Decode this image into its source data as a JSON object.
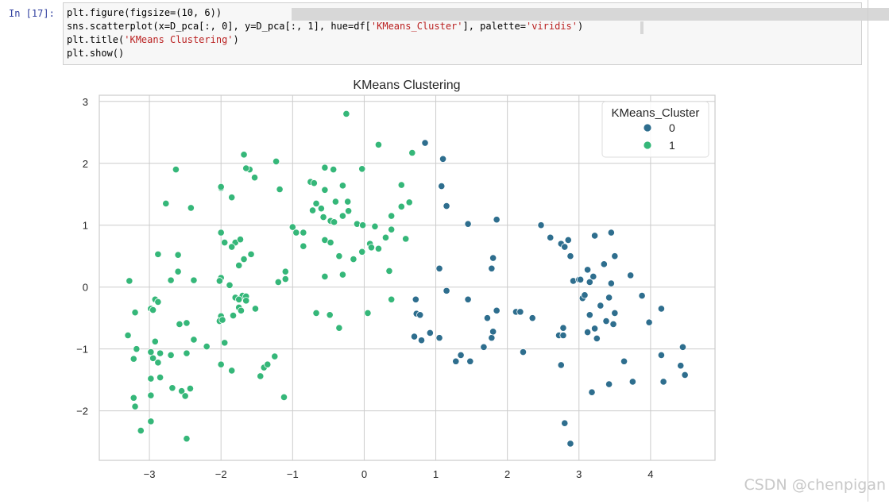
{
  "cell": {
    "prompt": "In  [17]:",
    "code": {
      "line1": "plt.figure(figsize=(10, 6))",
      "line2_a": "sns.scatterplot(x=D_pca[:, 0], y=D_pca[:, 1], hue=df[",
      "line2_str": "'KMeans_Cluster'",
      "line2_b": "], palette=",
      "line2_str2": "'viridis'",
      "line2_c": ")",
      "line3_a": "plt.title(",
      "line3_str": "'KMeans Clustering'",
      "line3_b": ")",
      "line4": "plt.show()"
    }
  },
  "watermark": "CSDN @chenpigan",
  "chart_data": {
    "type": "scatter",
    "title": "KMeans Clustering",
    "xlabel": "",
    "ylabel": "",
    "xlim": [
      -3.7,
      4.9
    ],
    "ylim": [
      -2.8,
      3.1
    ],
    "xticks": [
      "−3",
      "−2",
      "−1",
      "0",
      "1",
      "2",
      "3",
      "4"
    ],
    "yticks": [
      "−2",
      "−1",
      "0",
      "1",
      "2",
      "3"
    ],
    "grid": true,
    "legend": {
      "title": "KMeans_Cluster",
      "position": "top-right",
      "entries": [
        "0",
        "1"
      ]
    },
    "colors": {
      "0": "#2e6e8e",
      "1": "#35b779"
    },
    "series": [
      {
        "name": "0",
        "points": [
          [
            0.85,
            2.33
          ],
          [
            1.1,
            2.07
          ],
          [
            1.08,
            1.63
          ],
          [
            1.15,
            1.31
          ],
          [
            1.45,
            1.02
          ],
          [
            1.85,
            1.09
          ],
          [
            1.05,
            0.3
          ],
          [
            1.8,
            0.47
          ],
          [
            1.78,
            0.3
          ],
          [
            0.72,
            -0.2
          ],
          [
            1.15,
            -0.06
          ],
          [
            1.45,
            -0.2
          ],
          [
            1.85,
            -0.38
          ],
          [
            0.73,
            -0.43
          ],
          [
            0.78,
            -0.45
          ],
          [
            0.7,
            -0.8
          ],
          [
            0.8,
            -0.86
          ],
          [
            0.92,
            -0.74
          ],
          [
            1.05,
            -0.82
          ],
          [
            1.28,
            -1.2
          ],
          [
            1.35,
            -1.1
          ],
          [
            1.48,
            -1.2
          ],
          [
            1.67,
            -0.97
          ],
          [
            1.72,
            -0.5
          ],
          [
            1.78,
            -0.82
          ],
          [
            1.8,
            -0.72
          ],
          [
            2.12,
            -0.4
          ],
          [
            2.18,
            -0.4
          ],
          [
            2.22,
            -1.05
          ],
          [
            2.35,
            -0.5
          ],
          [
            2.47,
            1.0
          ],
          [
            2.6,
            0.8
          ],
          [
            2.75,
            0.7
          ],
          [
            2.8,
            0.65
          ],
          [
            2.85,
            0.76
          ],
          [
            2.88,
            0.5
          ],
          [
            2.92,
            0.1
          ],
          [
            3.0,
            0.12
          ],
          [
            3.02,
            0.12
          ],
          [
            3.12,
            0.28
          ],
          [
            3.15,
            0.08
          ],
          [
            3.2,
            0.17
          ],
          [
            3.22,
            0.83
          ],
          [
            3.35,
            0.37
          ],
          [
            3.45,
            0.88
          ],
          [
            3.5,
            0.5
          ],
          [
            3.45,
            0.06
          ],
          [
            3.05,
            -0.18
          ],
          [
            3.08,
            -0.13
          ],
          [
            3.15,
            -0.45
          ],
          [
            3.3,
            -0.3
          ],
          [
            3.38,
            -0.55
          ],
          [
            3.42,
            -0.17
          ],
          [
            3.5,
            -0.42
          ],
          [
            3.48,
            -0.6
          ],
          [
            3.22,
            -0.67
          ],
          [
            3.12,
            -0.73
          ],
          [
            3.25,
            -0.83
          ],
          [
            2.72,
            -0.78
          ],
          [
            2.78,
            -0.66
          ],
          [
            2.78,
            -0.78
          ],
          [
            2.75,
            -1.26
          ],
          [
            3.63,
            -1.2
          ],
          [
            3.72,
            0.19
          ],
          [
            3.88,
            -0.14
          ],
          [
            3.98,
            -0.57
          ],
          [
            4.15,
            -0.35
          ],
          [
            4.15,
            -1.1
          ],
          [
            4.18,
            -1.53
          ],
          [
            4.42,
            -1.27
          ],
          [
            4.45,
            -0.97
          ],
          [
            4.48,
            -1.42
          ],
          [
            3.18,
            -1.7
          ],
          [
            3.42,
            -1.57
          ],
          [
            3.75,
            -1.53
          ],
          [
            2.8,
            -2.2
          ],
          [
            2.88,
            -2.53
          ]
        ]
      },
      {
        "name": "1",
        "points": [
          [
            -0.25,
            2.8
          ],
          [
            0.2,
            2.3
          ],
          [
            0.67,
            2.17
          ],
          [
            -1.68,
            2.14
          ],
          [
            -1.6,
            1.9
          ],
          [
            -1.65,
            1.92
          ],
          [
            -1.53,
            1.77
          ],
          [
            -1.23,
            2.03
          ],
          [
            -1.18,
            1.58
          ],
          [
            -2.63,
            1.9
          ],
          [
            -2.77,
            1.35
          ],
          [
            -2.42,
            1.28
          ],
          [
            -2.0,
            1.6
          ],
          [
            -2.0,
            1.62
          ],
          [
            -1.85,
            1.45
          ],
          [
            -0.55,
            1.93
          ],
          [
            -0.43,
            1.9
          ],
          [
            -0.03,
            1.91
          ],
          [
            -0.75,
            1.7
          ],
          [
            -0.7,
            1.68
          ],
          [
            -0.3,
            1.64
          ],
          [
            -0.55,
            1.57
          ],
          [
            -0.4,
            1.38
          ],
          [
            -0.23,
            1.38
          ],
          [
            -0.67,
            1.35
          ],
          [
            -0.6,
            1.27
          ],
          [
            -0.72,
            1.24
          ],
          [
            -0.3,
            1.15
          ],
          [
            -0.47,
            1.07
          ],
          [
            -0.42,
            1.05
          ],
          [
            -0.57,
            1.13
          ],
          [
            -0.22,
            1.23
          ],
          [
            0.15,
            0.98
          ],
          [
            0.38,
            1.15
          ],
          [
            0.52,
            1.65
          ],
          [
            0.52,
            1.3
          ],
          [
            0.63,
            1.37
          ],
          [
            -0.1,
            1.02
          ],
          [
            -0.02,
            1.0
          ],
          [
            -1.0,
            0.97
          ],
          [
            -0.95,
            0.88
          ],
          [
            -0.85,
            0.66
          ],
          [
            0.08,
            0.7
          ],
          [
            0.2,
            0.62
          ],
          [
            0.1,
            0.64
          ],
          [
            0.3,
            0.8
          ],
          [
            0.38,
            0.93
          ],
          [
            0.58,
            0.78
          ],
          [
            -0.55,
            0.76
          ],
          [
            -0.47,
            0.72
          ],
          [
            -0.35,
            0.5
          ],
          [
            -0.15,
            0.45
          ],
          [
            -0.03,
            0.57
          ],
          [
            0.35,
            0.26
          ],
          [
            -0.55,
            0.17
          ],
          [
            -0.3,
            0.2
          ],
          [
            -2.0,
            0.88
          ],
          [
            -1.95,
            0.72
          ],
          [
            -1.8,
            0.72
          ],
          [
            -1.73,
            0.77
          ],
          [
            -1.85,
            0.65
          ],
          [
            -1.58,
            0.53
          ],
          [
            -1.68,
            0.45
          ],
          [
            -1.75,
            0.35
          ],
          [
            -2.0,
            0.15
          ],
          [
            -2.02,
            0.1
          ],
          [
            -1.88,
            0.03
          ],
          [
            -1.2,
            0.08
          ],
          [
            -1.1,
            0.25
          ],
          [
            -1.1,
            0.13
          ],
          [
            -2.88,
            0.53
          ],
          [
            -2.6,
            0.52
          ],
          [
            -2.7,
            0.11
          ],
          [
            -2.6,
            0.25
          ],
          [
            -2.38,
            0.11
          ],
          [
            -3.28,
            0.1
          ],
          [
            -3.2,
            -0.41
          ],
          [
            -1.8,
            -0.17
          ],
          [
            -1.7,
            -0.14
          ],
          [
            -1.65,
            -0.15
          ],
          [
            -1.75,
            -0.2
          ],
          [
            -1.65,
            -0.22
          ],
          [
            -1.52,
            -0.35
          ],
          [
            -1.75,
            -0.33
          ],
          [
            -1.72,
            -0.38
          ],
          [
            -1.83,
            -0.46
          ],
          [
            -2.0,
            -0.47
          ],
          [
            -2.02,
            -0.55
          ],
          [
            -1.98,
            -0.53
          ],
          [
            -0.67,
            -0.42
          ],
          [
            -0.48,
            -0.45
          ],
          [
            -0.35,
            -0.66
          ],
          [
            0.05,
            -0.42
          ],
          [
            0.38,
            -0.2
          ],
          [
            -2.98,
            -0.35
          ],
          [
            -2.95,
            -0.37
          ],
          [
            -2.92,
            -0.2
          ],
          [
            -2.88,
            -0.24
          ],
          [
            -2.58,
            -0.6
          ],
          [
            -2.48,
            -0.58
          ],
          [
            -2.92,
            -0.88
          ],
          [
            -2.38,
            -0.85
          ],
          [
            -2.2,
            -0.96
          ],
          [
            -1.95,
            -0.9
          ],
          [
            -3.3,
            -0.78
          ],
          [
            -3.18,
            -1.0
          ],
          [
            -3.22,
            -1.16
          ],
          [
            -2.98,
            -1.05
          ],
          [
            -2.95,
            -1.15
          ],
          [
            -2.85,
            -1.07
          ],
          [
            -2.88,
            -1.22
          ],
          [
            -2.7,
            -1.1
          ],
          [
            -2.48,
            -1.07
          ],
          [
            -2.0,
            -1.25
          ],
          [
            -1.85,
            -1.35
          ],
          [
            -1.45,
            -1.44
          ],
          [
            -1.4,
            -1.3
          ],
          [
            -1.35,
            -1.25
          ],
          [
            -1.25,
            -1.12
          ],
          [
            -2.98,
            -1.48
          ],
          [
            -2.85,
            -1.46
          ],
          [
            -2.98,
            -1.75
          ],
          [
            -2.68,
            -1.63
          ],
          [
            -2.55,
            -1.68
          ],
          [
            -2.5,
            -1.76
          ],
          [
            -2.43,
            -1.64
          ],
          [
            -3.22,
            -1.79
          ],
          [
            -3.2,
            -1.93
          ],
          [
            -3.12,
            -2.32
          ],
          [
            -2.98,
            -2.17
          ],
          [
            -2.48,
            -2.45
          ],
          [
            -1.12,
            -1.78
          ],
          [
            -0.85,
            0.88
          ]
        ]
      }
    ]
  }
}
